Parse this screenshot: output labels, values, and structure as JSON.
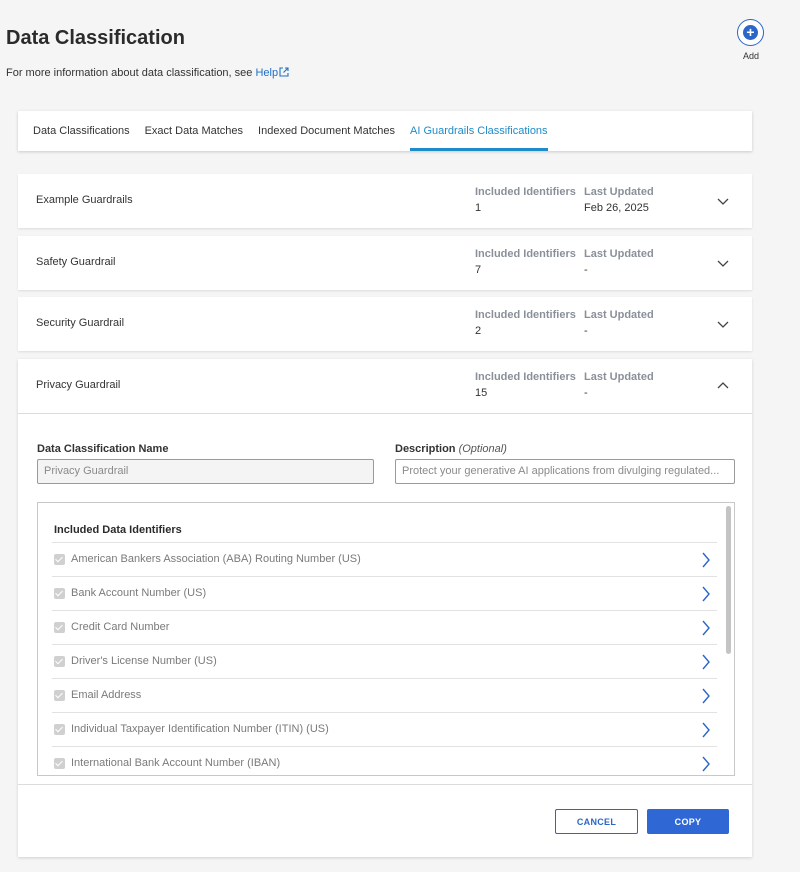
{
  "header": {
    "title": "Data Classification",
    "subtitle_text": "For more information about data classification, see ",
    "help_link": "Help",
    "add_label": "Add"
  },
  "tabs": [
    {
      "label": "Data Classifications",
      "active": false
    },
    {
      "label": "Exact Data Matches",
      "active": false
    },
    {
      "label": "Indexed Document Matches",
      "active": false
    },
    {
      "label": "AI Guardrails Classifications",
      "active": true
    }
  ],
  "columns": {
    "included": "Included Identifiers",
    "updated": "Last Updated"
  },
  "classifications": [
    {
      "name": "Example Guardrails",
      "included": "1",
      "updated": "Feb 26, 2025",
      "expanded": false
    },
    {
      "name": "Safety Guardrail",
      "included": "7",
      "updated": "-",
      "expanded": false
    },
    {
      "name": "Security Guardrail",
      "included": "2",
      "updated": "-",
      "expanded": false
    },
    {
      "name": "Privacy Guardrail",
      "included": "15",
      "updated": "-",
      "expanded": true
    }
  ],
  "detail": {
    "name_label": "Data Classification Name",
    "name_value": "Privacy Guardrail",
    "desc_label": "Description",
    "desc_optional": "(Optional)",
    "desc_value": "Protect your generative AI applications from divulging regulated...",
    "identifiers_title": "Included Data Identifiers",
    "identifiers": [
      {
        "label": "American Bankers Association (ABA) Routing Number (US)",
        "checked": true
      },
      {
        "label": "Bank Account Number (US)",
        "checked": true
      },
      {
        "label": "Credit Card Number",
        "checked": true
      },
      {
        "label": "Driver's License Number (US)",
        "checked": true
      },
      {
        "label": "Email Address",
        "checked": true
      },
      {
        "label": "Individual Taxpayer Identification Number (ITIN) (US)",
        "checked": true
      },
      {
        "label": "International Bank Account Number (IBAN)",
        "checked": true
      }
    ]
  },
  "actions": {
    "cancel": "CANCEL",
    "copy": "COPY"
  },
  "colors": {
    "accent": "#1f8bc8",
    "primary_button": "#2f68d4",
    "link": "#1f6fc5"
  }
}
